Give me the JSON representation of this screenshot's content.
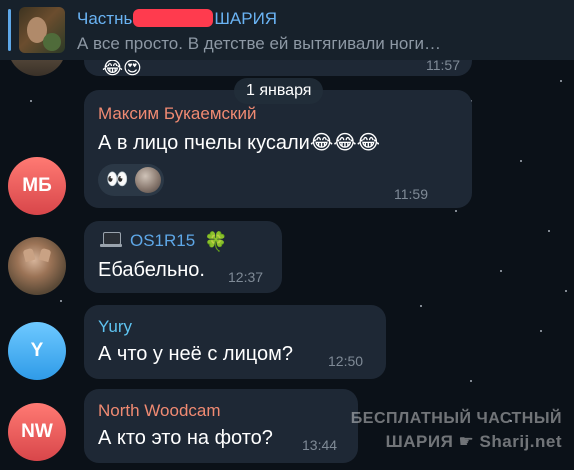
{
  "pinned": {
    "title_start": "Частнь",
    "title_end": "ШАРИЯ",
    "preview": "А все просто. В детстве ей вытягивали ноги…"
  },
  "top_message": {
    "emoji": "😂😍",
    "time": "11:57"
  },
  "date_separator": "1 января",
  "messages": [
    {
      "avatar_initials": "МБ",
      "avatar_color": "#e5534b",
      "sender": "Максим Букаемский",
      "sender_color": "#f08a72",
      "text": "А в лицо пчелы кусали😂😂😂",
      "reaction_emoji": "👀",
      "time": "11:59"
    },
    {
      "avatar_initials": "",
      "sender": "OS1R15",
      "sender_color": "#5ea7e7",
      "sender_emoji": "🍀",
      "text": "Ебабельно.",
      "time": "12:37"
    },
    {
      "avatar_initials": "Y",
      "avatar_color": "#3aa7f0",
      "sender": "Yury",
      "sender_color": "#5ec3f0",
      "text": "А что у неё с лицом?",
      "time": "12:50"
    },
    {
      "avatar_initials": "NW",
      "avatar_color": "#e5534b",
      "sender": "North Woodcam",
      "sender_color": "#f08a72",
      "text": "А кто это на фото?",
      "time": "13:44"
    }
  ],
  "watermark": {
    "line1": "БЕСПЛАТНЫЙ ЧАСТНЫЙ",
    "line2_a": "ШАРИЯ",
    "line2_b": "Sharij.net"
  }
}
